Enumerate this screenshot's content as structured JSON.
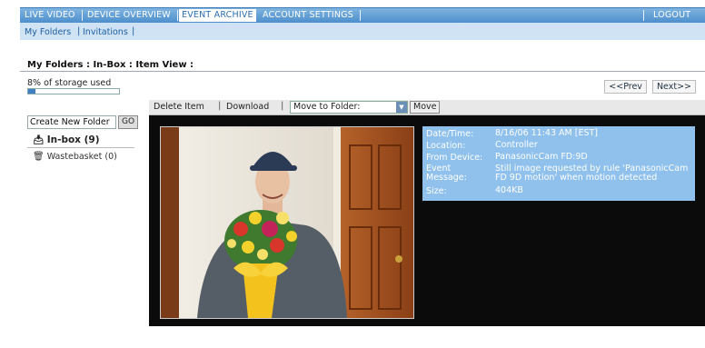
{
  "nav": {
    "tabs": [
      {
        "label": "LIVE VIDEO"
      },
      {
        "label": "DEVICE OVERVIEW"
      },
      {
        "label": "EVENT ARCHIVE"
      },
      {
        "label": "ACCOUNT SETTINGS"
      }
    ],
    "logout": "LOGOUT",
    "active_tab": "EVENT ARCHIVE"
  },
  "subnav": {
    "my_folders": "My Folders",
    "invitations": "Invitations",
    "separator": "|"
  },
  "breadcrumb": "My Folders : In-Box : Item View :",
  "storage": {
    "label": "8% of storage used",
    "percent": 8
  },
  "pager": {
    "prev": "<<Prev",
    "next": "Next>>"
  },
  "sidebar": {
    "new_folder_value": "Create New Folder",
    "go_label": "GO",
    "inbox_label": "In-box (9)",
    "wastebasket_label": "Wastebasket (0)"
  },
  "toolbar": {
    "delete_label": "Delete Item",
    "download_label": "Download",
    "move_to_folder": "Move to Folder:",
    "move_label": "Move"
  },
  "event": {
    "datetime_label": "Date/Time:",
    "datetime": "8/16/06 11:43 AM [EST]",
    "location_label": "Location:",
    "location": "Controller",
    "device_label": "From Device:",
    "device": "PanasonicCam FD:9D",
    "message_label": "Event Message:",
    "message": "Still image requested by rule 'PanasonicCam FD 9D motion' when motion detected",
    "size_label": "Size:",
    "size": "404KB"
  },
  "icons": {
    "inbox": "inbox-tray-icon",
    "wastebasket": "trash-can-icon",
    "dropdown": "chevron-down-icon"
  },
  "colors": {
    "nav": "#4d8fcc",
    "info_panel": "#8fc1ec",
    "viewer": "#0b0b0b"
  }
}
